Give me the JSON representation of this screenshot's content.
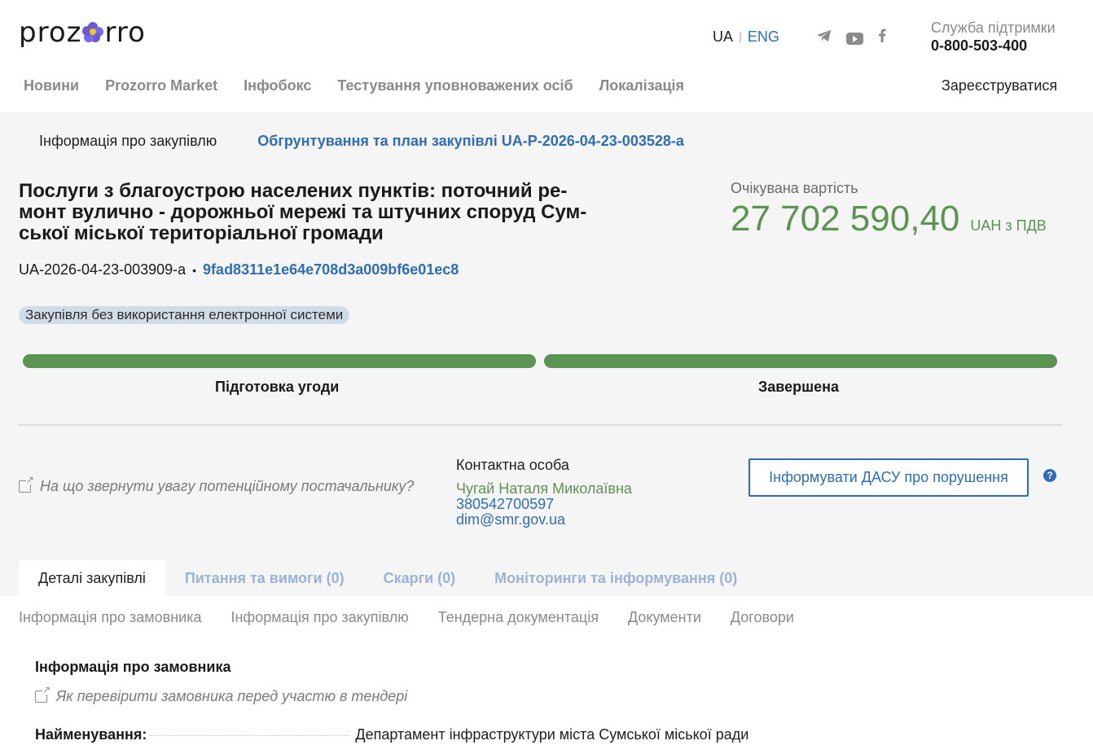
{
  "header": {
    "logo_left": "proz",
    "logo_right": "rro",
    "lang_ua": "UA",
    "lang_eng": "ENG",
    "support_label": "Служба підтримки",
    "support_phone": "0-800-503-400",
    "register": "Зареєструватися",
    "nav": [
      "Новини",
      "Prozorro Market",
      "Інфобокс",
      "Тестування уповноважених осіб",
      "Локалізація"
    ],
    "social_icons": [
      "telegram-icon",
      "youtube-icon",
      "facebook-icon"
    ]
  },
  "subtabs": {
    "info": "Інформація про закупівлю",
    "plan_link": "Обгрунтування та план закупівлі UA-P-2026-04-23-003528-a"
  },
  "tender": {
    "title": "Послуги з благоустрою населених пунктів: поточний ре-монт вулично - дорожньої мережі та штучних споруд Сум-ської міської територіальної громади",
    "title_lines": [
      "Послуги з благоустрою населених пунктів: поточний ре-",
      "монт вулично - дорожньої мережі та штучних споруд Сум-",
      "ської міської територіальної громади"
    ],
    "id": "UA-2026-04-23-003909-a",
    "hash": "9fad8311e1e64e708d3a009bf6e01ec8",
    "badge": "Закупівля без використання електронної системи",
    "value_label": "Очікувана вартість",
    "value_amount": "27 702 590,40",
    "value_currency": "UAH з ПДВ"
  },
  "progress": {
    "stages": [
      {
        "label": "Підготовка угоди",
        "complete": 1.0
      },
      {
        "label": "Завершена",
        "complete": 1.0
      }
    ],
    "color": "#5b9451"
  },
  "supplier_hint": "На що звернути увагу потенційному постачальнику?",
  "contact": {
    "label": "Контактна особа",
    "name": "Чугай Наталя Миколаївна",
    "phone": "380542700597",
    "email": "dim@smr.gov.ua"
  },
  "dasu_button": "Інформувати ДАСУ про порушення",
  "help_symbol": "?",
  "tabs": [
    "Деталі закупівлі",
    "Питання та вимоги (0)",
    "Скарги (0)",
    "Моніторинги та інформування (0)"
  ],
  "sections": [
    "Інформація про замовника",
    "Інформація про закупівлю",
    "Тендерна документація",
    "Документи",
    "Договори"
  ],
  "customer": {
    "title": "Інформація про замовника",
    "hint": "Як перевірити замовника перед участю в тендері",
    "name_key": "Найменування:",
    "name_value": "Департамент інфраструктури міста Сумської міської ради"
  },
  "colors": {
    "accent_blue": "#2f6db5",
    "accent_green": "#5b9451",
    "background_gray": "#f5f5f5"
  }
}
